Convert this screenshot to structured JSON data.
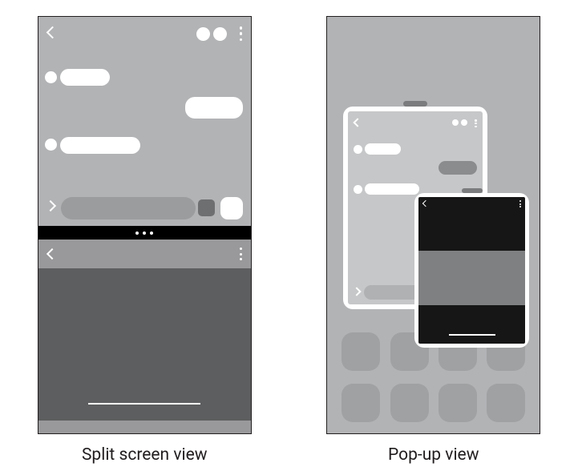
{
  "left_caption": "Split screen view",
  "right_caption": "Pop-up view"
}
